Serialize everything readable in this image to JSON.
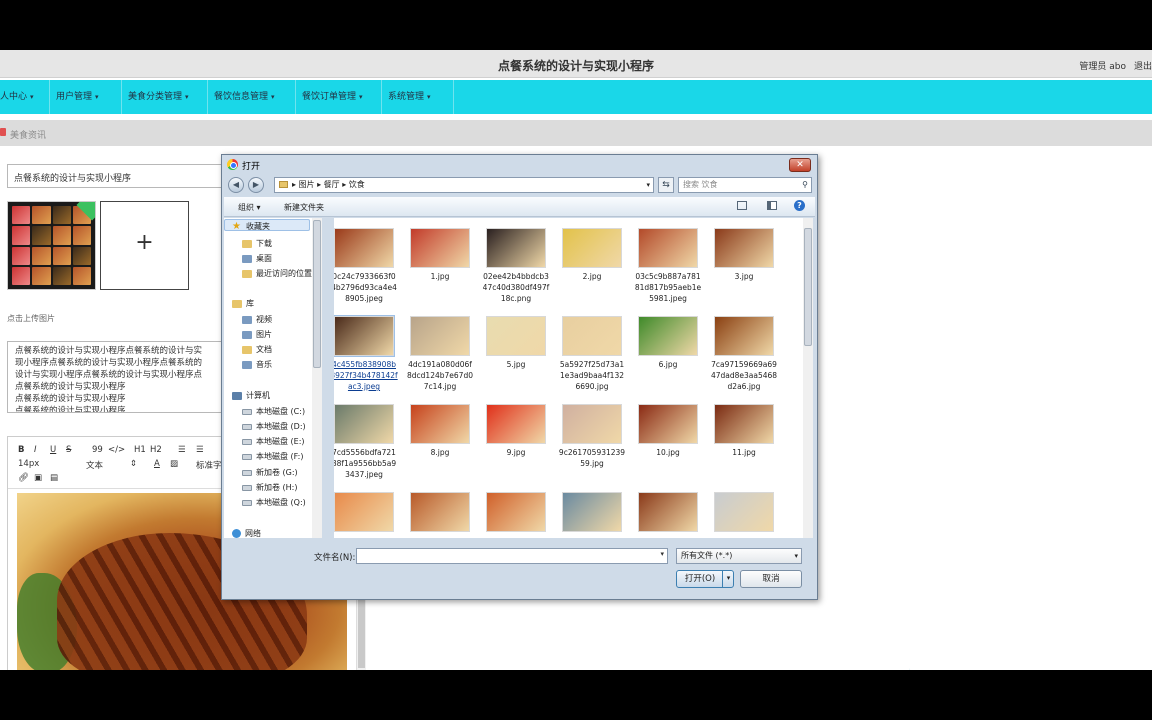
{
  "app": {
    "title": "点餐系统的设计与实现小程序",
    "admin_label": "管理员 abo",
    "logout_label": "退出"
  },
  "nav": {
    "items": [
      {
        "label": "人中心"
      },
      {
        "label": "用户管理"
      },
      {
        "label": "美食分类管理"
      },
      {
        "label": "餐饮信息管理"
      },
      {
        "label": "餐饮订单管理"
      },
      {
        "label": "系统管理"
      }
    ]
  },
  "breadcrumb": {
    "text": "美食资讯"
  },
  "form": {
    "title_value": "点餐系统的设计与实现小程序",
    "upload_plus": "+",
    "upload_hint": "点击上传图片",
    "description_lines": [
      "点餐系统的设计与实现小程序点餐系统的设计与实",
      "现小程序点餐系统的设计与实现小程序点餐系统的",
      "设计与实现小程序点餐系统的设计与实现小程序点",
      "点餐系统的设计与实现小程序",
      "点餐系统的设计与实现小程序",
      "点餐系统的设计与实现小程序"
    ]
  },
  "editor": {
    "toolbar_row1": [
      "B",
      "I",
      "U",
      "S",
      "99",
      "</>",
      "H1",
      "H2",
      "☰",
      "☰"
    ],
    "font_size": "14px",
    "font_type": "文本",
    "font_color": "A",
    "style_label": "标准字"
  },
  "dialog": {
    "title": "打开",
    "close": "✕",
    "path": [
      "图片",
      "餐厅",
      "饮食"
    ],
    "search_placeholder": "搜索 饮食",
    "organize": "组织",
    "new_folder": "新建文件夹",
    "sidebar": {
      "favorites": "收藏夹",
      "downloads": "下载",
      "desktop": "桌面",
      "recent": "最近访问的位置",
      "library": "库",
      "videos": "视频",
      "pictures": "图片",
      "documents": "文档",
      "music": "音乐",
      "computer": "计算机",
      "drives": [
        "本地磁盘 (C:)",
        "本地磁盘 (D:)",
        "本地磁盘 (E:)",
        "本地磁盘 (F:)",
        "新加卷 (G:)",
        "新加卷 (H:)",
        "本地磁盘 (Q:)"
      ],
      "network": "网络"
    },
    "files": [
      {
        "name": "0c24c7933663f04b2796d93ca4e48905.jpeg",
        "color": "#9a3a1a"
      },
      {
        "name": "1.jpg",
        "color": "#c23b2a"
      },
      {
        "name": "02ee42b4bbdcb347c40d380df497f18c.png",
        "color": "#2a2020"
      },
      {
        "name": "2.jpg",
        "color": "#e2c24a"
      },
      {
        "name": "03c5c9b887a78181d817b95aeb1e5981.jpeg",
        "color": "#b34a2a"
      },
      {
        "name": "3.jpg",
        "color": "#8a3a1a"
      },
      {
        "name": "4c455fb838908b3927f34b478142fac3.jpeg",
        "color": "#4a2a1a"
      },
      {
        "name": "4dc191a080d06f8dcd124b7e67d07c14.jpg",
        "color": "#b8a48a"
      },
      {
        "name": "5.jpg",
        "color": "#e8dcb0"
      },
      {
        "name": "5a5927f25d73a11e3ad9baa4f1326690.jpg",
        "color": "#e8cfa0"
      },
      {
        "name": "6.jpg",
        "color": "#3f8a2a"
      },
      {
        "name": "7ca97159669a6947dad8e3aa5468d2a6.jpg",
        "color": "#8a4012"
      },
      {
        "name": "7cd5556bdfa72188f1a9556bb5a93437.jpeg",
        "color": "#6a7a6a"
      },
      {
        "name": "8.jpg",
        "color": "#c6421c"
      },
      {
        "name": "9.jpg",
        "color": "#e0301a"
      },
      {
        "name": "9c26170593123959.jpg",
        "color": "#d0b0a0"
      },
      {
        "name": "10.jpg",
        "color": "#8a2a14"
      },
      {
        "name": "11.jpg",
        "color": "#7a2a12"
      },
      {
        "name": "",
        "color": "#e88a4a"
      },
      {
        "name": "",
        "color": "#b85a2a"
      },
      {
        "name": "",
        "color": "#d0602a"
      },
      {
        "name": "",
        "color": "#6a8aa0"
      },
      {
        "name": "",
        "color": "#8a3a1a"
      },
      {
        "name": "",
        "color": "#c8ccd0"
      }
    ],
    "filename_label": "文件名(N):",
    "filename_value": "",
    "filetype": "所有文件 (*.*)",
    "open_button": "打开(O)",
    "cancel_button": "取消"
  }
}
